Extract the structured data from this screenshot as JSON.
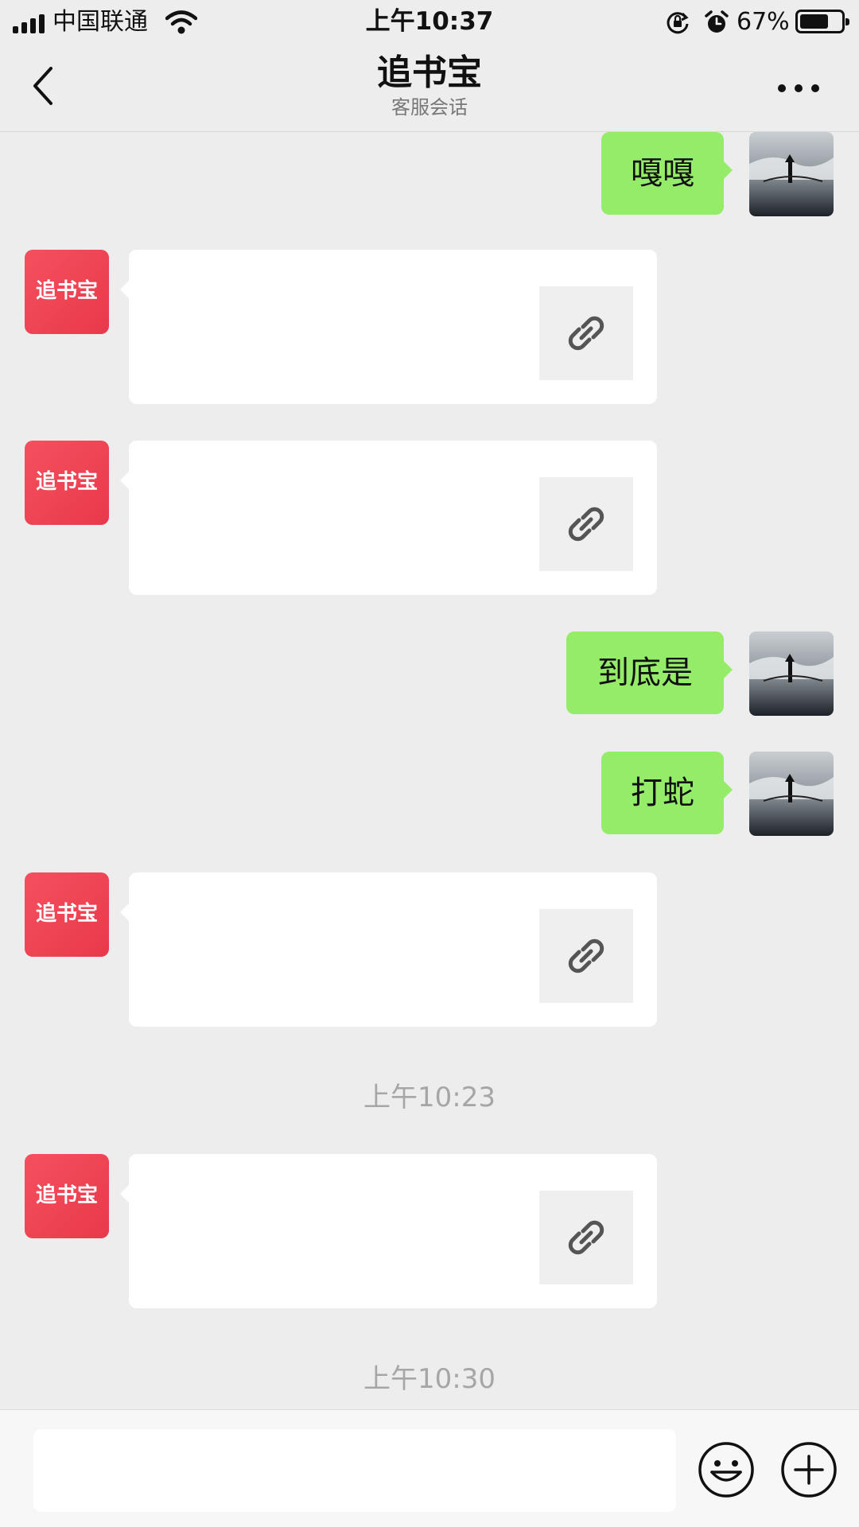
{
  "status_bar": {
    "carrier": "中国联通",
    "time": "上午10:37",
    "battery": "67%",
    "battery_level": 0.67
  },
  "header": {
    "title": "追书宝",
    "subtitle": "客服会话"
  },
  "messages": [
    {
      "from": "me",
      "text": "嘎嘎"
    },
    {
      "from": "app",
      "type": "link",
      "avatar_label": "追书宝"
    },
    {
      "from": "app",
      "type": "link",
      "avatar_label": "追书宝"
    },
    {
      "from": "me",
      "text": "到底是"
    },
    {
      "from": "me",
      "text": "打蛇"
    },
    {
      "from": "app",
      "type": "link",
      "avatar_label": "追书宝"
    },
    {
      "from": "system",
      "type": "timestamp",
      "text": "上午10:23"
    },
    {
      "from": "app",
      "type": "link",
      "avatar_label": "追书宝"
    },
    {
      "from": "system",
      "type": "timestamp",
      "text": "上午10:30"
    }
  ],
  "input": {
    "value": "",
    "placeholder": ""
  },
  "icons": {
    "back": "chevron-left-icon",
    "more": "more-dots-icon",
    "link": "link-icon",
    "emoji": "emoji-icon",
    "plus": "plus-icon"
  },
  "colors": {
    "outgoing_bubble": "#95ec69",
    "incoming_bubble": "#ffffff",
    "app_avatar": "#f04456",
    "background": "#ededed"
  }
}
